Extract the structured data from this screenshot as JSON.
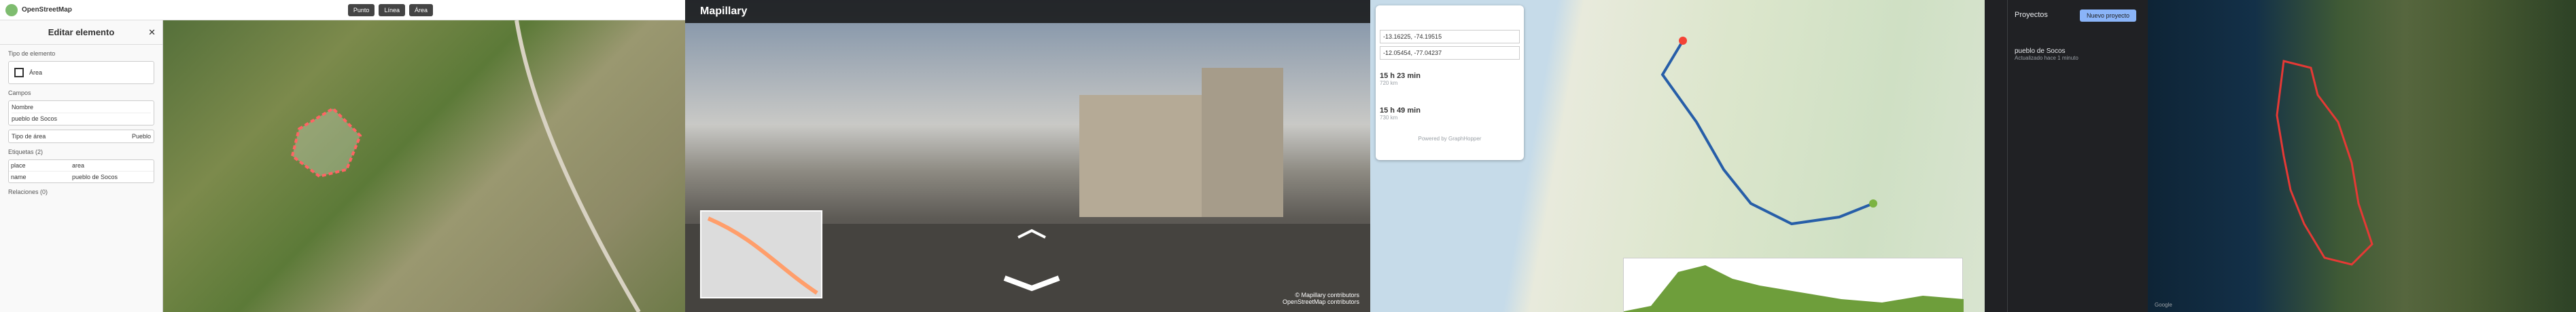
{
  "panel1": {
    "app_title": "OpenStreetMap",
    "editor_title": "Editar elemento",
    "toolbar": {
      "point": "Punto",
      "line": "Línea",
      "area": "Área"
    },
    "sections": {
      "feature_type": "Tipo de elemento",
      "field_area": "Área",
      "fields": "Campos",
      "name_label": "Nombre",
      "name_value": "pueblo de Socos",
      "type_label": "Tipo de área",
      "type_value": "Pueblo",
      "tags_header": "Etiquetas (2)",
      "tag1_key": "place",
      "tag1_val": "area",
      "tag2_key": "name",
      "tag2_val": "pueblo de Socos",
      "relations_header": "Relaciones (0)"
    },
    "colors": {
      "sidebar": "#f9f9f9",
      "accent": "#7092ff",
      "selection": "#ff6464"
    }
  },
  "panel2": {
    "logo": "Mapillary",
    "credit_line1": "© Mapillary contributors",
    "credit_line2": "OpenStreetMap contributors",
    "colors": {
      "toolbar": "#141414",
      "accent": "#05cb63"
    }
  },
  "panel3": {
    "from": "-13.16225, -74.19515",
    "to": "-12.05454, -77.04237",
    "option1_time": "15 h 23 min",
    "option1_dist": "720 km",
    "option2_time": "15 h 49 min",
    "option2_dist": "730 km",
    "powered": "Powered by GraphHopper",
    "colors": {
      "route": "#275ea8",
      "elevation_fill": "#6e9e3b"
    }
  },
  "panel4": {
    "title": "Proyectos",
    "new_button": "Nuevo proyecto",
    "project_name": "pueblo de Socos",
    "project_subtitle": "Actualizado hace 1 minuto",
    "footer_text": "Google",
    "colors": {
      "accent": "#8ab4f8",
      "boundary": "#e53935"
    }
  }
}
